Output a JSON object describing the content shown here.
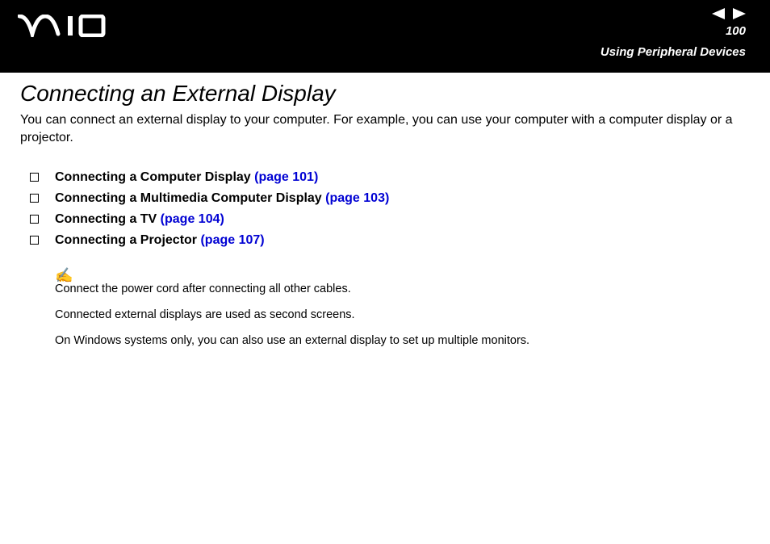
{
  "header": {
    "page_number": "100",
    "section_name": "Using Peripheral Devices"
  },
  "page": {
    "title": "Connecting an External Display",
    "intro": "You can connect an external display to your computer. For example, you can use your computer with a computer display or a projector."
  },
  "toc": [
    {
      "label": "Connecting a Computer Display ",
      "link": "(page 101)"
    },
    {
      "label": "Connecting a Multimedia Computer Display ",
      "link": "(page 103)"
    },
    {
      "label": "Connecting a TV ",
      "link": "(page 104)"
    },
    {
      "label": "Connecting a Projector ",
      "link": "(page 107)"
    }
  ],
  "notes": {
    "icon": "✍",
    "lines": [
      "Connect the power cord after connecting all other cables.",
      "Connected external displays are used as second screens.",
      "On Windows systems only, you can also use an external display to set up multiple monitors."
    ]
  }
}
